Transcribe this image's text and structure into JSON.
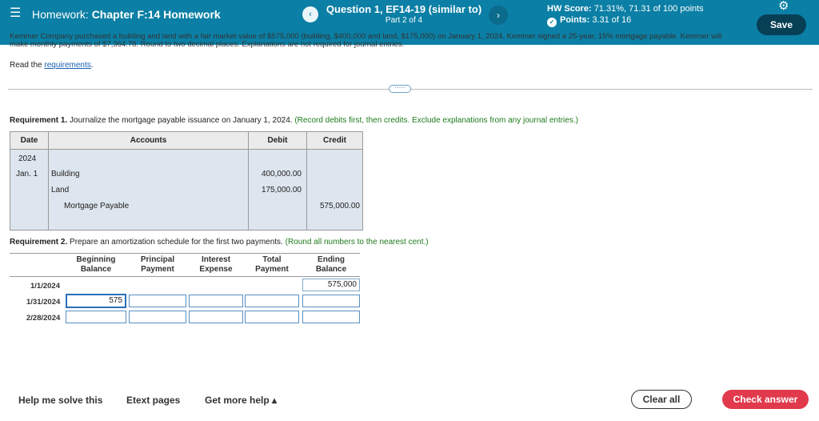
{
  "header": {
    "menu_icon": "hamburger-icon",
    "homework_prefix": "Homework: ",
    "homework_name": "Chapter F:14 Homework",
    "question_title": "Question 1, EF14-19 (similar to)",
    "question_part": "Part 2 of 4",
    "prev_icon": "chevron-left-icon",
    "next_icon": "chevron-right-icon",
    "hw_score_label": "HW Score: ",
    "hw_score_value": "71.31%, 71.31 of 100 points",
    "points_label": "Points: ",
    "points_value": "3.31 of 16",
    "settings_icon": "gear-icon",
    "save_label": "Save"
  },
  "problem": {
    "line1": "Kemmer Company purchased a building and land with a fair market value of $575,000 (building, $400,000 and land, $175,000) on January 1, 2024. Kemmer signed a 25-year, 15% mortgage payable. Kemmer will",
    "line2": "make monthly payments of $7,364.78. Round to two decimal places. Explanations are not required for journal entries.",
    "read_prefix": "Read the ",
    "read_link": "requirements",
    "read_suffix": "."
  },
  "divider_label": "·····",
  "requirement1": {
    "label": "Requirement 1.",
    "text": " Journalize the mortgage payable issuance on January 1, 2024. ",
    "note": "(Record debits first, then credits. Exclude explanations from any journal entries.)"
  },
  "journal": {
    "headers": {
      "date": "Date",
      "accounts": "Accounts",
      "debit": "Debit",
      "credit": "Credit"
    },
    "year": "2024",
    "rows": [
      {
        "date": "Jan. 1",
        "account": "Building",
        "debit": "400,000.00",
        "credit": ""
      },
      {
        "date": "",
        "account": "Land",
        "debit": "175,000.00",
        "credit": ""
      },
      {
        "date": "",
        "account": "Mortgage Payable",
        "debit": "",
        "credit": "575,000.00"
      }
    ]
  },
  "requirement2": {
    "label": "Requirement 2.",
    "text": " Prepare an amortization schedule for the first two payments. ",
    "note": "(Round all numbers to the nearest cent.)"
  },
  "amortization": {
    "headers": {
      "beginning": [
        "Beginning",
        "Balance"
      ],
      "principal": [
        "Principal",
        "Payment"
      ],
      "interest": [
        "Interest",
        "Expense"
      ],
      "total": [
        "Total",
        "Payment"
      ],
      "ending": [
        "Ending",
        "Balance"
      ]
    },
    "rows": [
      {
        "date": "1/1/2024",
        "ending": "575,000"
      },
      {
        "date": "1/31/2024",
        "beginning": "575",
        "principal": "",
        "interest": "",
        "total": "",
        "ending": ""
      },
      {
        "date": "2/28/2024",
        "beginning": "",
        "principal": "",
        "interest": "",
        "total": "",
        "ending": ""
      }
    ]
  },
  "footer": {
    "help_label": "Help me solve this",
    "etext_label": "Etext pages",
    "more_help_label": "Get more help ▴",
    "clear_label": "Clear all",
    "check_label": "Check answer"
  }
}
